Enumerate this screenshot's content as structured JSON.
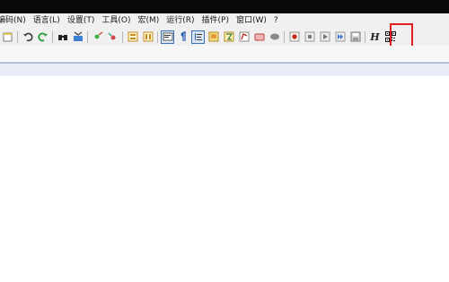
{
  "menus": [
    "编码(N)",
    "语言(L)",
    "设置(T)",
    "工具(O)",
    "宏(M)",
    "运行(R)",
    "插件(P)",
    "窗口(W)",
    "?"
  ],
  "toolbar": {
    "highlighted_button": "qr-code-icon",
    "help_glyph": "H",
    "icons": [
      "open-file-icon",
      "undo-icon",
      "redo-icon",
      "find-icon",
      "replace-icon",
      "zoom-in-icon",
      "zoom-out-icon",
      "sync-vertical-icon",
      "sync-horizontal-icon",
      "word-wrap-icon",
      "show-all-chars-icon",
      "indent-guide-icon",
      "doc-map-icon",
      "function-list-icon",
      "folder-workspace-icon",
      "monitoring-icon",
      "record-macro-icon",
      "stop-macro-icon",
      "play-macro-icon",
      "run-macro-multiple-icon",
      "save-macro-icon",
      "help-icon",
      "qr-code-icon"
    ]
  },
  "colors": {
    "highlight": "#e02020",
    "accent": "#3c6fb5"
  }
}
